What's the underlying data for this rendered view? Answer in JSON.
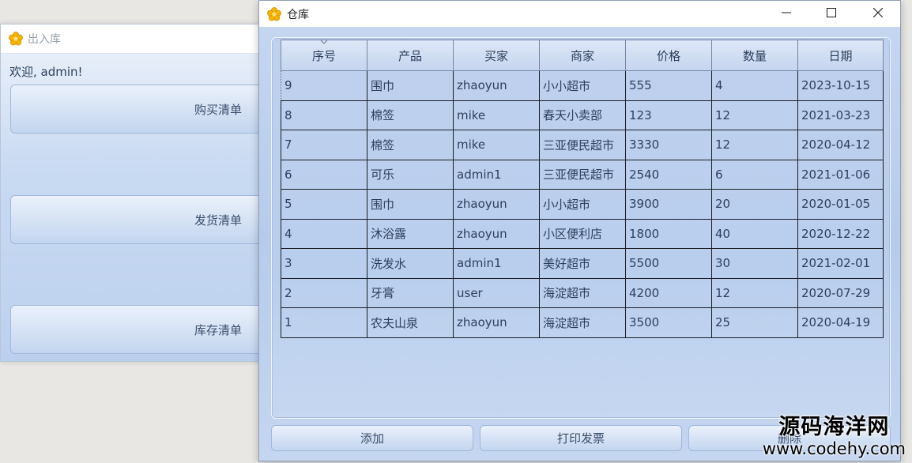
{
  "back_window": {
    "title": "出入库",
    "welcome": "欢迎, admin!",
    "buttons": {
      "purchase": "购买清单",
      "shipping": "发货清单",
      "inventory": "库存清单"
    }
  },
  "front_window": {
    "title": "仓库",
    "table": {
      "columns": [
        "序号",
        "产品",
        "买家",
        "商家",
        "价格",
        "数量",
        "日期"
      ],
      "rows": [
        [
          "9",
          "围巾",
          "zhaoyun",
          "小小超市",
          "555",
          "4",
          "2023-10-15"
        ],
        [
          "8",
          "棉签",
          "mike",
          "春天小卖部",
          "123",
          "12",
          "2021-03-23"
        ],
        [
          "7",
          "棉签",
          "mike",
          "三亚便民超市",
          "3330",
          "12",
          "2020-04-12"
        ],
        [
          "6",
          "可乐",
          "admin1",
          "三亚便民超市",
          "2540",
          "6",
          "2021-01-06"
        ],
        [
          "5",
          "围巾",
          "zhaoyun",
          "小小超市",
          "3900",
          "20",
          "2020-01-05"
        ],
        [
          "4",
          "沐浴露",
          "zhaoyun",
          "小区便利店",
          "1800",
          "40",
          "2020-12-22"
        ],
        [
          "3",
          "洗发水",
          "admin1",
          "美好超市",
          "5500",
          "30",
          "2021-02-01"
        ],
        [
          "2",
          "牙膏",
          "user",
          "海淀超市",
          "4200",
          "12",
          "2020-07-29"
        ],
        [
          "1",
          "农夫山泉",
          "zhaoyun",
          "海淀超市",
          "3500",
          "25",
          "2020-04-19"
        ]
      ]
    },
    "buttons": {
      "add": "添加",
      "print_invoice": "打印发票",
      "delete": "删除"
    }
  },
  "watermark": {
    "title": "源码海洋网",
    "url": "www.codehy.com"
  },
  "icons": {
    "app": "flower-icon",
    "minimize": "minimize-icon",
    "maximize": "maximize-icon",
    "close": "close-icon",
    "sort": "sort-caret-icon"
  },
  "colors": {
    "window_bg": "#c6d7f1",
    "button_border": "#9fb8dc",
    "text": "#2d3f5c",
    "icon_yellow": "#f4b400"
  }
}
